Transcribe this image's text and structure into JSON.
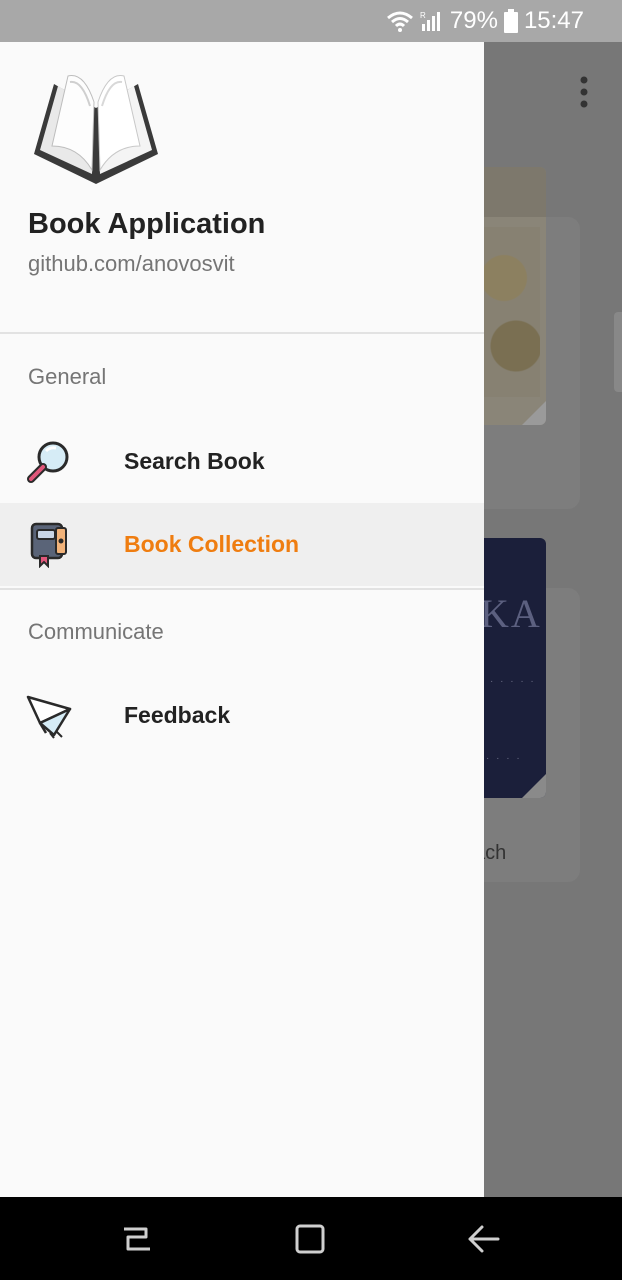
{
  "status_bar": {
    "battery": "79%",
    "time": "15:47",
    "icons": [
      "wifi-icon",
      "signal-icon",
      "battery-icon"
    ]
  },
  "drawer": {
    "app_title": "Book Application",
    "app_subtitle": "github.com/anovosvit",
    "logo_icon": "open-book-icon",
    "sections": [
      {
        "title": "General",
        "items": [
          {
            "label": "Search Book",
            "icon": "magnifier-icon",
            "active": false
          },
          {
            "label": "Book Collection",
            "icon": "notebook-icon",
            "active": true
          }
        ]
      },
      {
        "title": "Communicate",
        "items": [
          {
            "label": "Feedback",
            "icon": "paper-plane-icon",
            "active": false
          }
        ]
      }
    ]
  },
  "background": {
    "more_icon": "more-vert-icon",
    "partial_author": "ach",
    "partial_cover_title": "KA"
  },
  "colors": {
    "accent": "#ef7d10",
    "drawer_bg": "#fafafa",
    "active_row_bg": "#efefef"
  },
  "nav_bar": {
    "icons": [
      "recents-icon",
      "home-icon",
      "back-icon"
    ]
  }
}
